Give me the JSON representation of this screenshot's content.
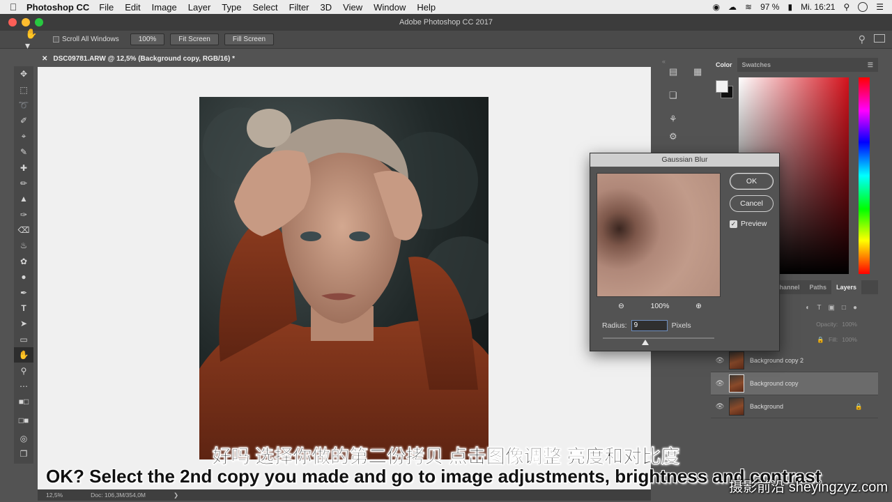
{
  "menubar": {
    "app_name": "Photoshop CC",
    "items": [
      "File",
      "Edit",
      "Image",
      "Layer",
      "Type",
      "Select",
      "Filter",
      "3D",
      "View",
      "Window",
      "Help"
    ],
    "battery": "97 %",
    "clock": "Mi. 16:21"
  },
  "window": {
    "title": "Adobe Photoshop CC 2017"
  },
  "options_bar": {
    "scroll_all_label": "Scroll All Windows",
    "zoom_btn": "100%",
    "fit_screen_btn": "Fit Screen",
    "fill_screen_btn": "Fill Screen"
  },
  "document": {
    "tab_title": "DSC09781.ARW @ 12,5% (Background copy, RGB/16) *",
    "status_zoom": "12,5%",
    "status_doc": "Doc: 106,3M/354,0M"
  },
  "color_panel": {
    "tabs": [
      "Color",
      "Swatches"
    ],
    "active_tab": "Color"
  },
  "layers_panel": {
    "tabs": [
      "Channel",
      "Paths",
      "Layers"
    ],
    "active_tab": "Layers",
    "opacity_label": "Opacity:",
    "opacity_value": "100%",
    "fill_label": "Fill:",
    "fill_value": "100%",
    "layers": [
      {
        "name": "Background copy 2",
        "selected": false,
        "locked": false
      },
      {
        "name": "Background copy",
        "selected": true,
        "locked": false
      },
      {
        "name": "Background",
        "selected": false,
        "locked": true
      }
    ]
  },
  "gaussian_blur": {
    "title": "Gaussian Blur",
    "ok": "OK",
    "cancel": "Cancel",
    "preview_label": "Preview",
    "preview_checked": true,
    "zoom_level": "100%",
    "radius_label": "Radius:",
    "radius_value": "9",
    "radius_unit": "Pixels"
  },
  "subtitles": {
    "chinese": "好吗 选择你做的第二份拷贝 点击图像调整 亮度和对比度",
    "english": "OK? Select the 2nd copy you made and go to image adjustments, brightness and contrast"
  },
  "watermark": "摄影前沿 sheyingzyz.com"
}
